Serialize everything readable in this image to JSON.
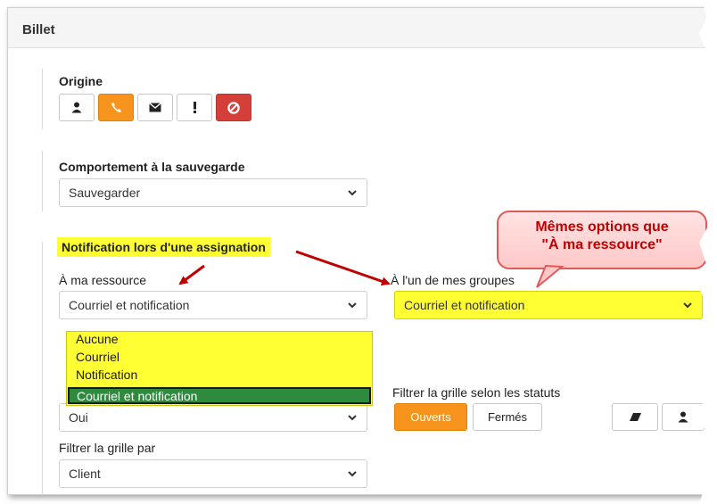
{
  "card": {
    "title": "Billet"
  },
  "origine": {
    "label": "Origine",
    "buttons": [
      {
        "icon": "person-icon"
      },
      {
        "icon": "phone-icon",
        "active": true
      },
      {
        "icon": "envelope-icon"
      },
      {
        "icon": "exclamation-icon"
      },
      {
        "icon": "ban-icon",
        "danger": true
      }
    ]
  },
  "sauvegarde": {
    "label": "Comportement à la sauvegarde",
    "value": "Sauvegarder"
  },
  "notification": {
    "section_label": "Notification lors d'une assignation",
    "ma_ressource": {
      "label": "À ma ressource",
      "value": "Courriel et notification",
      "options": [
        "Aucune",
        "Courriel",
        "Notification",
        "Courriel et notification"
      ]
    },
    "groupes": {
      "label": "À l'un de mes groupes",
      "value": "Courriel et notification"
    }
  },
  "callout": {
    "line1": "Mêmes options que",
    "line2": "\"À ma ressource\""
  },
  "grille_oui": {
    "value": "Oui"
  },
  "filtre_statuts": {
    "label": "Filtrer la grille selon les statuts",
    "ouverts": "Ouverts",
    "fermes": "Fermés"
  },
  "filtre_par": {
    "label": "Filtrer la grille par",
    "value": "Client"
  },
  "colors": {
    "accent_orange": "#f7941d",
    "danger_red": "#d43f3a",
    "highlight_yellow": "#ffff33",
    "selected_green": "#2e8b3e",
    "arrow_red": "#c00000"
  }
}
